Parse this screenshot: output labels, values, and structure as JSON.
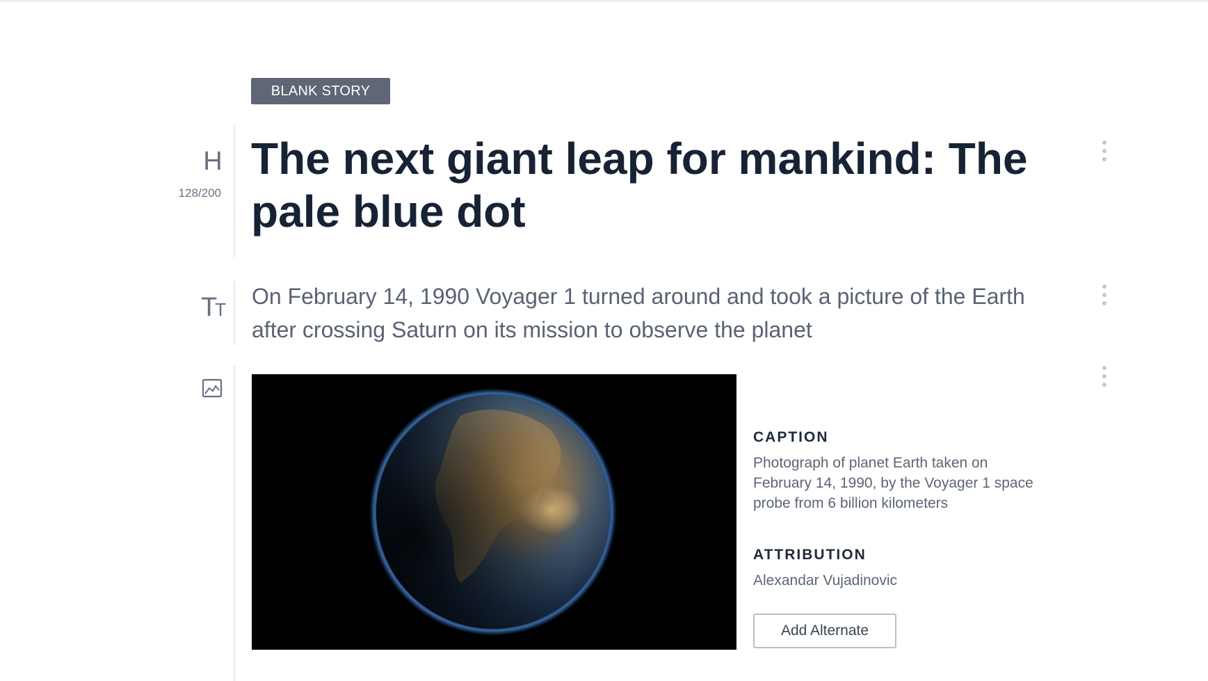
{
  "story": {
    "badge": "BLANK STORY"
  },
  "headline_block": {
    "icon": "heading-icon",
    "icon_glyph": "H",
    "char_count": "128/200",
    "text": "The next giant leap for mankind: The pale blue dot"
  },
  "subheadline_block": {
    "icon": "text-size-icon",
    "icon_glyph_large": "T",
    "icon_glyph_small": "T",
    "text": "On February 14, 1990 Voyager 1 turned around and took a picture of the Earth after crossing Saturn on its mission to observe the planet"
  },
  "image_block": {
    "icon": "image-icon",
    "image_subject": "planet Earth from space",
    "caption_label": "CAPTION",
    "caption": "Photograph of planet Earth taken on February 14, 1990, by the Voyager 1 space probe from 6 billion kilometers",
    "attribution_label": "ATTRIBUTION",
    "attribution": "Alexandar Vujadinovic",
    "add_alternate_label": "Add Alternate"
  },
  "colors": {
    "badge_bg": "#5f6776",
    "headline_text": "#172335",
    "body_text": "#586273",
    "divider": "#e4e6ea",
    "kebab_dots": "#c3c8cf"
  }
}
